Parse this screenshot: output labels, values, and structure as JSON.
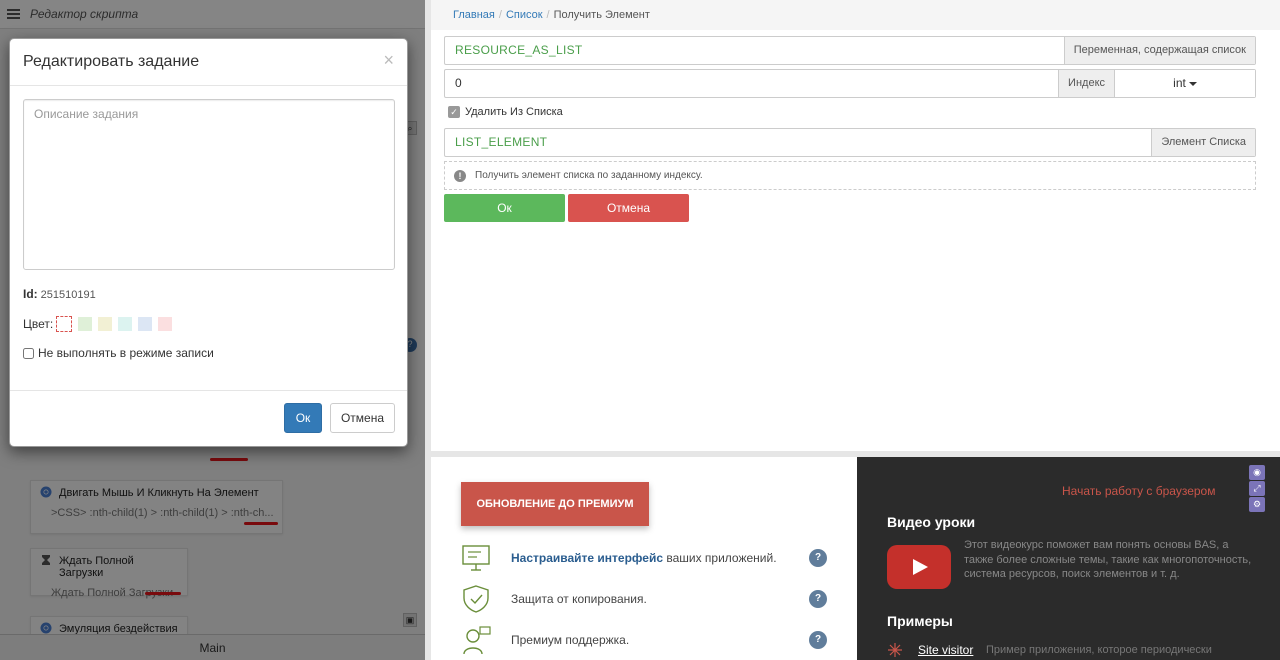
{
  "left": {
    "title": "Редактор скрипта",
    "tasks": [
      {
        "title": "Двигать Мышь И Кликнуть На Элемент",
        "sub": ">CSS> :nth-child(1) > :nth-child(1) > :nth-ch..."
      },
      {
        "title": "Ждать Полной Загрузки",
        "sub": "Ждать Полной Загрузки"
      },
      {
        "title": "Эмуляция бездействия",
        "sub": ""
      }
    ],
    "bottom_tab": "Main"
  },
  "modal": {
    "title": "Редактировать задание",
    "close": "×",
    "description_placeholder": "Описание задания",
    "id_label": "Id:",
    "id_value": "251510191",
    "color_label": "Цвет:",
    "colors": [
      "#ffffff",
      "#dff0d8",
      "#f5f5dc",
      "#dff5f3",
      "#dfe8f5",
      "#fde0e0"
    ],
    "record_label": "Не выполнять в режиме записи",
    "ok": "Ок",
    "cancel": "Отмена"
  },
  "breadcrumb": {
    "home": "Главная",
    "list": "Список",
    "current": "Получить Элемент"
  },
  "form": {
    "list_var": "RESOURCE_AS_LIST",
    "list_var_label": "Переменная, содержащая список",
    "index_value": "0",
    "index_label": "Индекс",
    "index_type": "int",
    "remove_label": "Удалить Из Списка",
    "element_var": "LIST_ELEMENT",
    "element_label": "Элемент Списка",
    "hint": "Получить элемент списка по заданному индексу.",
    "ok": "Ок",
    "cancel": "Отмена"
  },
  "premium": {
    "button": "ОБНОВЛЕНИЕ ДО ПРЕМИУМ",
    "features": [
      {
        "bold": "Настраивайте интерфейс",
        "rest": " ваших приложений."
      },
      {
        "bold": "",
        "rest": "Защита от копирования."
      },
      {
        "bold": "",
        "rest": "Премиум поддержка."
      }
    ],
    "q": "?"
  },
  "dark": {
    "start_browser": "Начать работу с браузером",
    "video_title": "Видео уроки",
    "video_desc": "Этот видеокурс поможет вам понять основы BAS, а также более сложные темы, такие как многопоточность, система ресурсов, поиск элементов и т. д.",
    "examples_title": "Примеры",
    "example_link": "Site visitor",
    "example_desc": "Пример приложения, которое периодически"
  }
}
